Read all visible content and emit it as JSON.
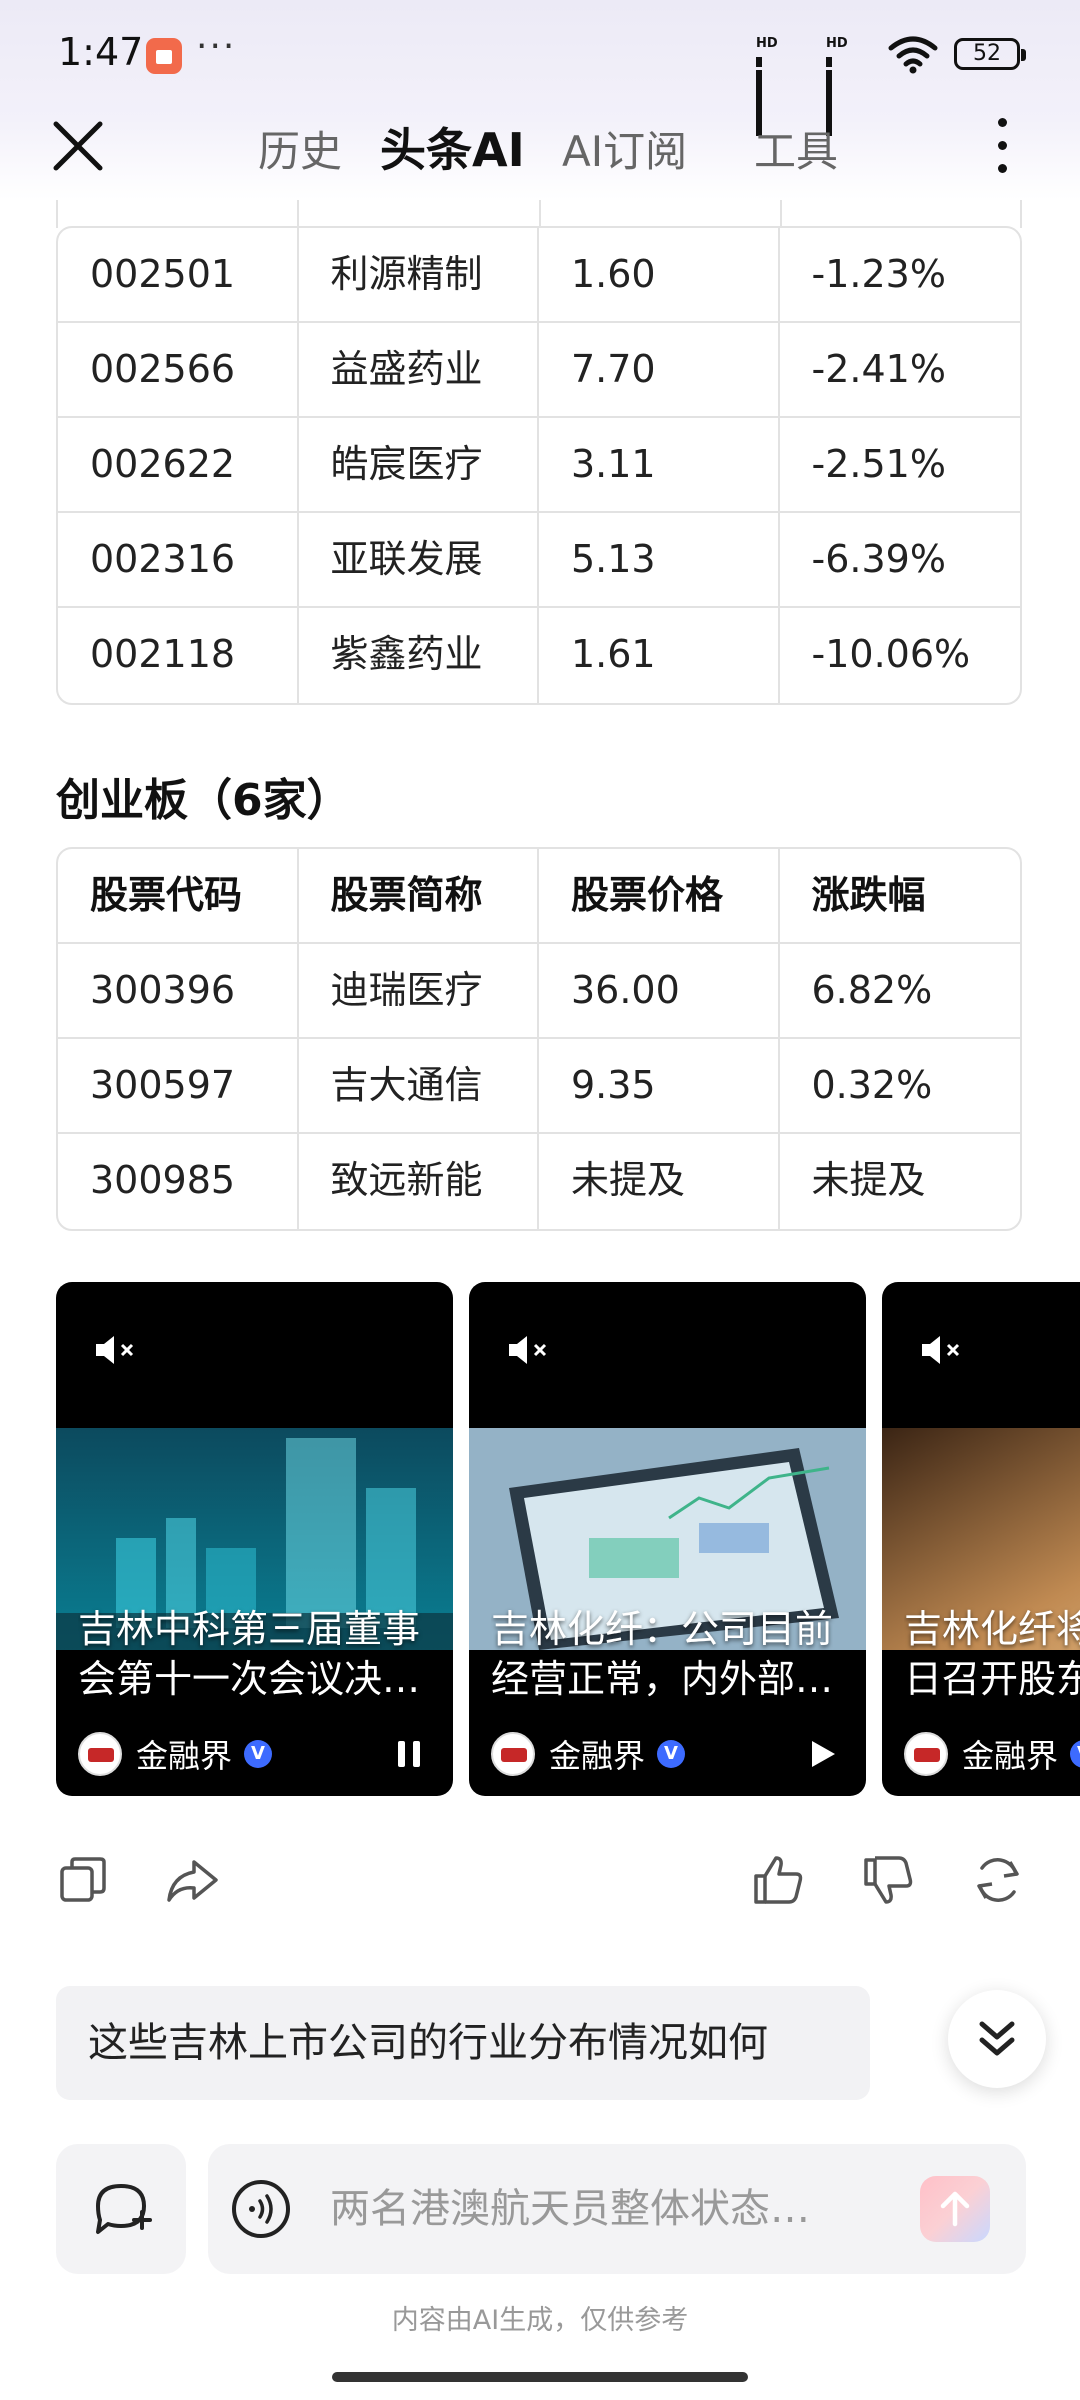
{
  "status_bar": {
    "time": "1:47",
    "battery": "52",
    "signal_label_1": "HD",
    "signal_label_2": "HD"
  },
  "nav": {
    "tabs": [
      {
        "label": "历史"
      },
      {
        "label": "头条AI",
        "active": true
      },
      {
        "label": "AI订阅"
      },
      {
        "label": "工具"
      }
    ]
  },
  "table_top": {
    "rows": [
      [
        "002501",
        "利源精制",
        "1.60",
        "-1.23%"
      ],
      [
        "002566",
        "益盛药业",
        "7.70",
        "-2.41%"
      ],
      [
        "002622",
        "皓宸医疗",
        "3.11",
        "-2.51%"
      ],
      [
        "002316",
        "亚联发展",
        "5.13",
        "-6.39%"
      ],
      [
        "002118",
        "紫鑫药业",
        "1.61",
        "-10.06%"
      ]
    ]
  },
  "section_chinext": {
    "title": "创业板（6家）",
    "headers": [
      "股票代码",
      "股票简称",
      "股票价格",
      "涨跌幅"
    ],
    "rows": [
      [
        "300396",
        "迪瑞医疗",
        "36.00",
        "6.82%"
      ],
      [
        "300597",
        "吉大通信",
        "9.35",
        "0.32%"
      ],
      [
        "300985",
        "致远新能",
        "未提及",
        "未提及"
      ]
    ]
  },
  "videos": [
    {
      "caption_line1": "吉林中科第三届董事",
      "caption_line2": "会第十一次会议决…",
      "source": "金融界",
      "control": "pause-icon"
    },
    {
      "caption_line1": "吉林化纤：公司目前",
      "caption_line2": "经营正常，内外部…",
      "source": "金融界",
      "control": "play-icon"
    },
    {
      "caption_line1": "吉林化纤将",
      "caption_line2": "日召开股东",
      "source": "金融界",
      "control": ""
    }
  ],
  "suggestion": "这些吉林上市公司的行业分布情况如何",
  "input": {
    "placeholder": "两名港澳航天员整体状态…"
  },
  "disclaimer": "内容由AI生成，仅供参考",
  "colors": {
    "accent_blue": "#3d6bff",
    "send_gradient_start": "#ffc0c8",
    "send_gradient_end": "#c9d8ff"
  }
}
